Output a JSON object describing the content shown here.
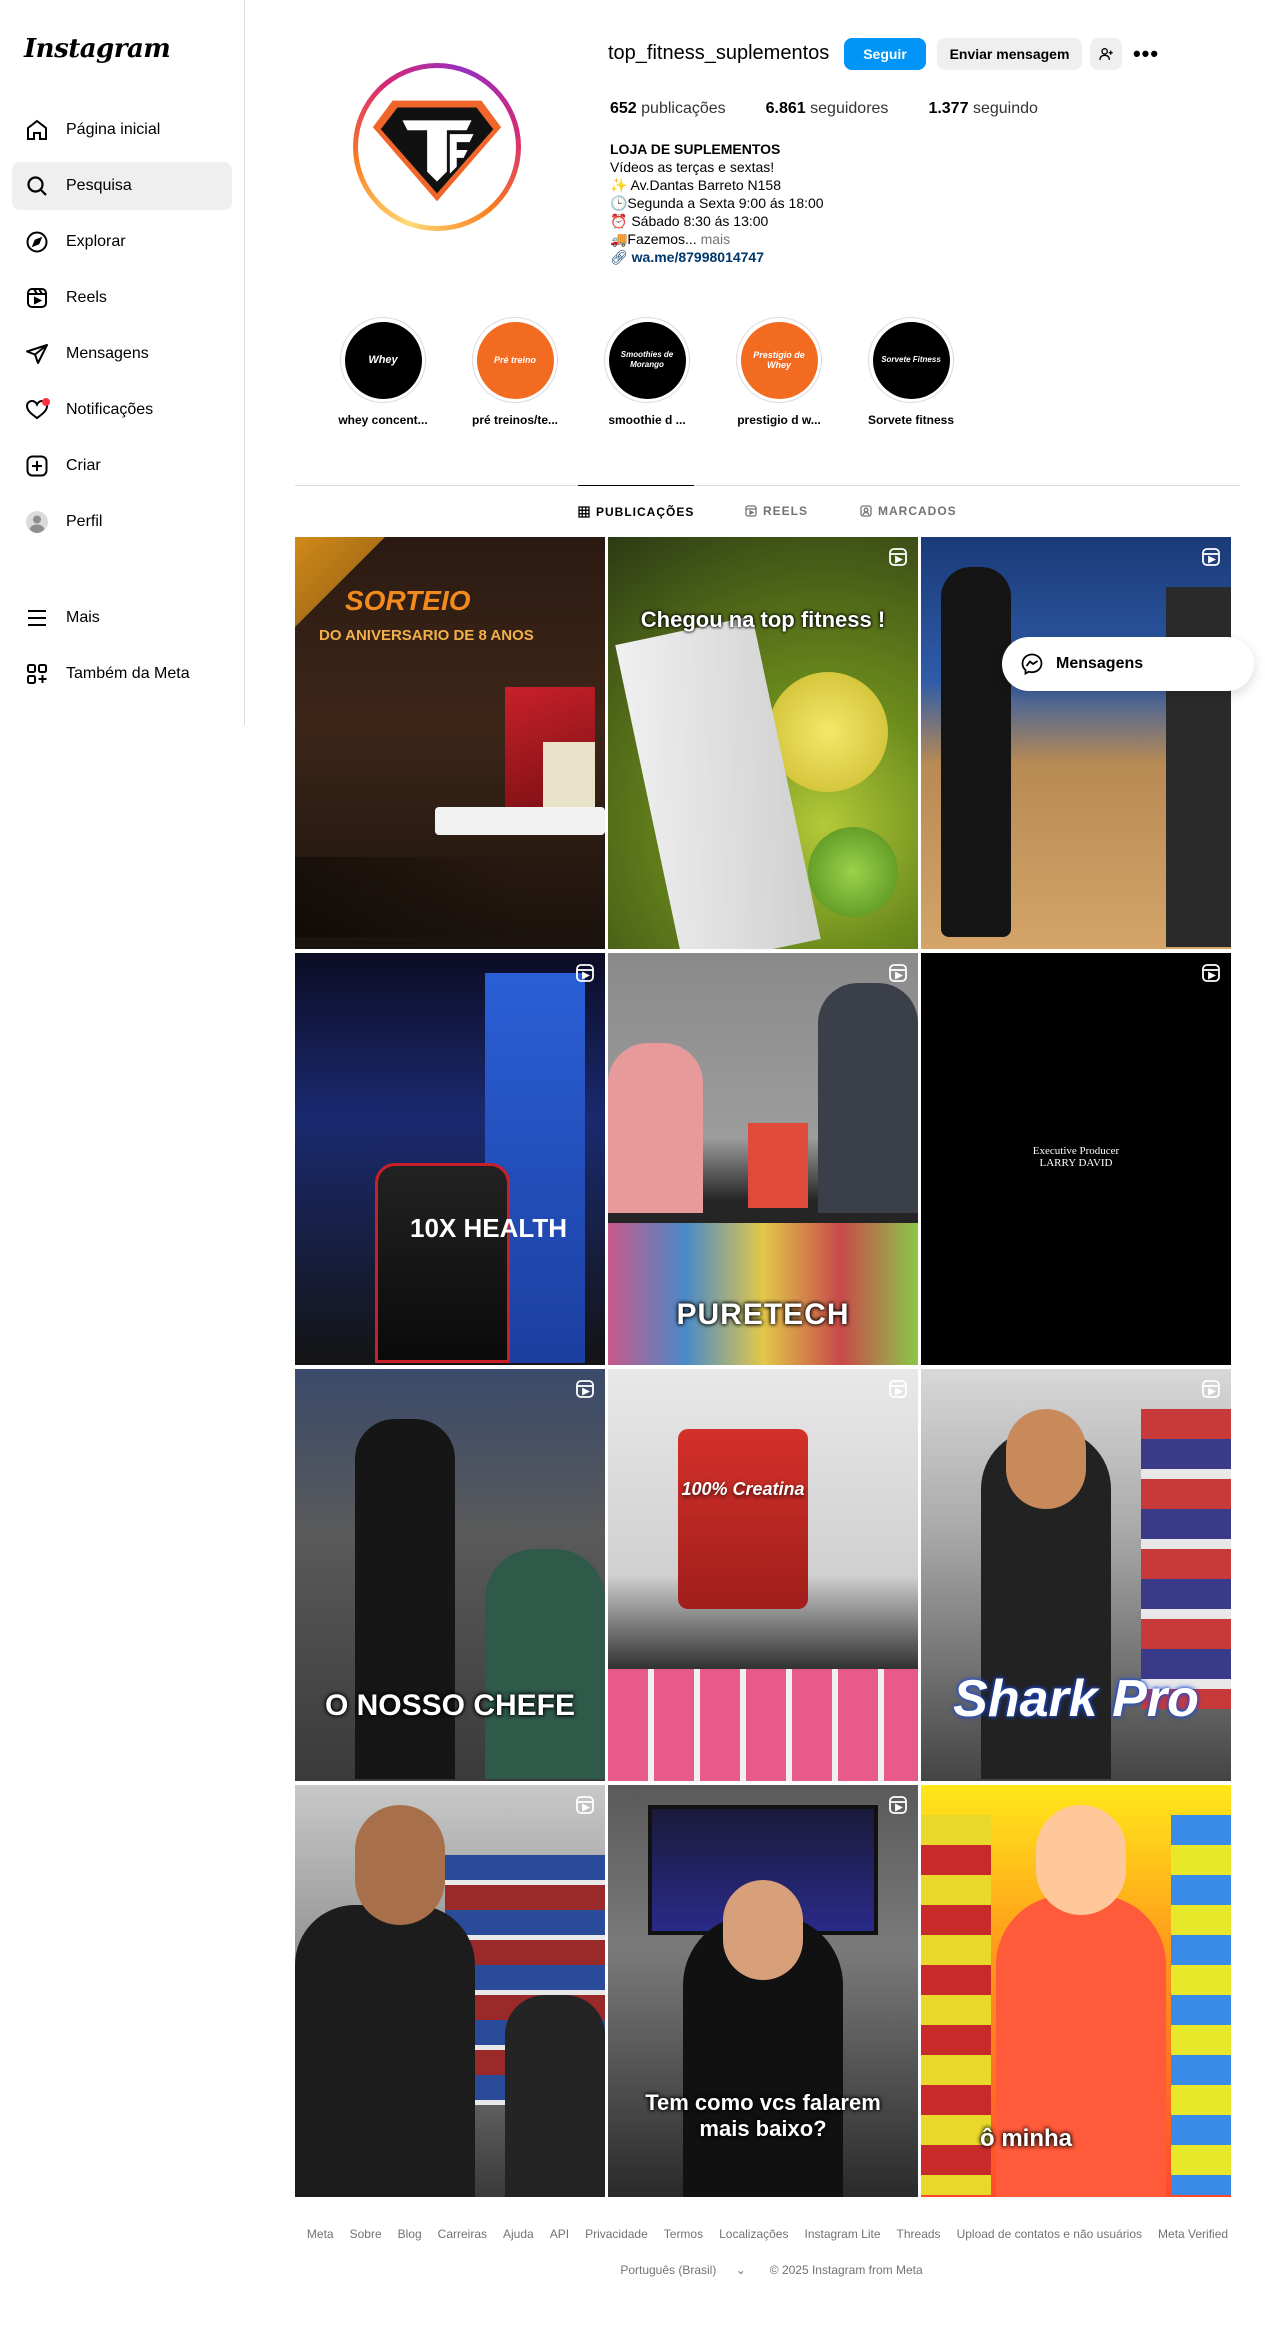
{
  "app": {
    "logo": "Instagram"
  },
  "sidebar": {
    "items": [
      {
        "label": "Página inicial",
        "icon": "home-icon"
      },
      {
        "label": "Pesquisa",
        "icon": "search-icon",
        "active": true
      },
      {
        "label": "Explorar",
        "icon": "compass-icon"
      },
      {
        "label": "Reels",
        "icon": "reels-icon"
      },
      {
        "label": "Mensagens",
        "icon": "direct-icon"
      },
      {
        "label": "Notificações",
        "icon": "heart-icon"
      },
      {
        "label": "Criar",
        "icon": "plus-icon"
      },
      {
        "label": "Perfil",
        "icon": "avatar-icon"
      },
      {
        "label": "Mais",
        "icon": "menu-icon"
      },
      {
        "label": "Também da Meta",
        "icon": "threads-icon"
      }
    ]
  },
  "profile": {
    "username": "top_fitness_suplementos",
    "follow_label": "Seguir",
    "message_label": "Enviar mensagem",
    "stats": {
      "posts_count": "652",
      "posts_label": "publicações",
      "followers_count": "6.861",
      "followers_label": "seguidores",
      "following_count": "1.377",
      "following_label": "seguindo"
    },
    "bio": {
      "name": "LOJA DE SUPLEMENTOS",
      "line1": "Vídeos as terças e sextas!",
      "line2": "✨ Av.Dantas Barreto N158",
      "line3": "🕒Segunda a Sexta 9:00 ás 18:00",
      "line4": "⏰ Sábado 8:30 ás 13:00",
      "line5": "🚚Fazemos...",
      "more": "mais",
      "link": "wa.me/87998014747"
    }
  },
  "highlights": [
    {
      "label": "whey concent...",
      "cover_text": "Whey",
      "color": "#000000"
    },
    {
      "label": "pré treinos/te...",
      "cover_text": "Pré treino",
      "color": "#f26b21"
    },
    {
      "label": "smoothie d ...",
      "cover_text": "Smoothies de Morango",
      "color": "#000000"
    },
    {
      "label": "prestigio d w...",
      "cover_text": "Prestígio de Whey",
      "color": "#f26b21"
    },
    {
      "label": "Sorvete fitness",
      "cover_text": "Sorvete Fitness",
      "color": "#000000"
    }
  ],
  "tabs": [
    {
      "label": "PUBLICAÇÕES",
      "active": true
    },
    {
      "label": "REELS"
    },
    {
      "label": "MARCADOS"
    }
  ],
  "posts": [
    {
      "caption": "SORTEIO",
      "sub": "DO ANIVERSARIO DE 8 ANOS"
    },
    {
      "caption": "Chegou na top fitness !"
    },
    {
      "caption": ""
    },
    {
      "caption": "10X HEALTH"
    },
    {
      "caption": "PURETECH"
    },
    {
      "caption": "Executive Producer LARRY DAVID"
    },
    {
      "caption": "O NOSSO CHEFE"
    },
    {
      "caption": "100% Creatina"
    },
    {
      "caption": "Shark Pro"
    },
    {
      "caption": ""
    },
    {
      "caption": "Tem como vcs falarem mais baixo?"
    },
    {
      "caption": "ô minha"
    }
  ],
  "floating": {
    "messages_label": "Mensagens"
  },
  "footer": {
    "links": [
      "Meta",
      "Sobre",
      "Blog",
      "Carreiras",
      "Ajuda",
      "API",
      "Privacidade",
      "Termos",
      "Localizações",
      "Instagram Lite",
      "Threads",
      "Upload de contatos e não usuários",
      "Meta Verified"
    ],
    "language": "Português (Brasil)",
    "copyright": "© 2025 Instagram from Meta"
  }
}
